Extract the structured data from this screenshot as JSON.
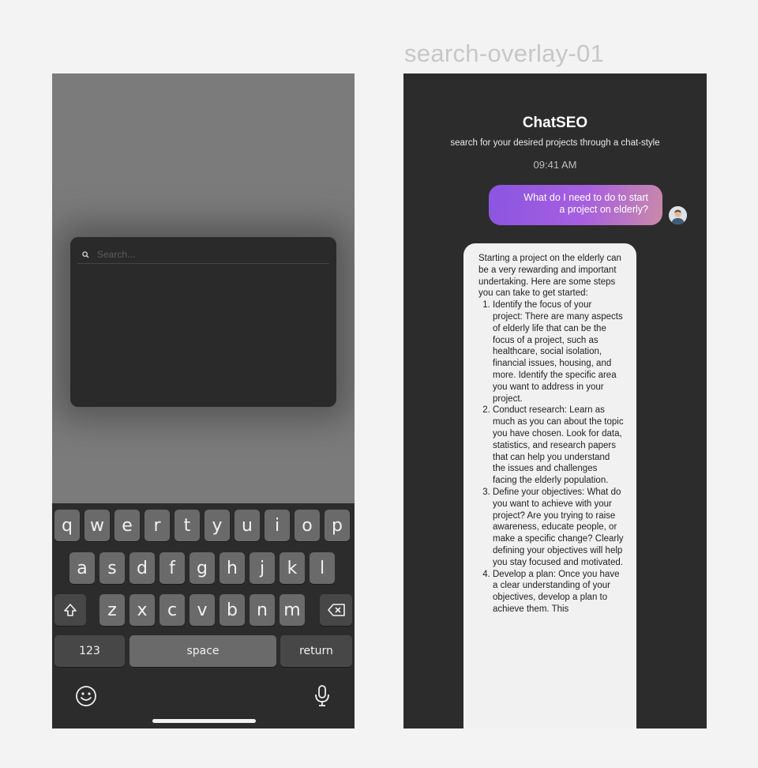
{
  "search_overlay": {
    "placeholder": "Search..."
  },
  "keyboard": {
    "row1": [
      "q",
      "w",
      "e",
      "r",
      "t",
      "y",
      "u",
      "i",
      "o",
      "p"
    ],
    "row2": [
      "a",
      "s",
      "d",
      "f",
      "g",
      "h",
      "j",
      "k",
      "l"
    ],
    "row3": [
      "z",
      "x",
      "c",
      "v",
      "b",
      "n",
      "m"
    ],
    "numbers_label": "123",
    "space_label": "space",
    "return_label": "return",
    "shift_icon": "shift-icon",
    "delete_icon": "backspace-icon",
    "emoji_icon": "emoji-icon",
    "mic_icon": "microphone-icon"
  },
  "frame_label": "search-overlay-01",
  "chat": {
    "title": "ChatSEO",
    "subtitle": "search for your desired projects through a chat-style",
    "timestamp": "09:41 AM",
    "user_message_line1": "What do I need to do to start",
    "user_message_line2": "a project on elderly?",
    "bot_intro": "Starting a project on the elderly can be a very rewarding and important undertaking. Here are some steps you can take to get started:",
    "bot_steps": [
      "Identify the focus of your project: There are many aspects of elderly life that can be the focus of a project, such as healthcare, social isolation, financial issues, housing, and more. Identify the specific area you want to address in your project.",
      "Conduct research: Learn as much as you can about the topic you have chosen. Look for data, statistics, and research papers that can help you understand the issues and challenges facing the elderly population.",
      "Define your objectives: What do you want to achieve with your project? Are you trying to raise awareness, educate people, or make a specific change? Clearly defining your objectives will help you stay focused and motivated.",
      "Develop a plan: Once you have a clear understanding of your objectives, develop a plan to achieve them. This"
    ]
  },
  "colors": {
    "bubble_gradient_start": "#8a55e0",
    "bubble_gradient_end": "#c98aa8",
    "dark_bg": "#2c2c2c",
    "overlay_gray": "#7b7b7b"
  }
}
